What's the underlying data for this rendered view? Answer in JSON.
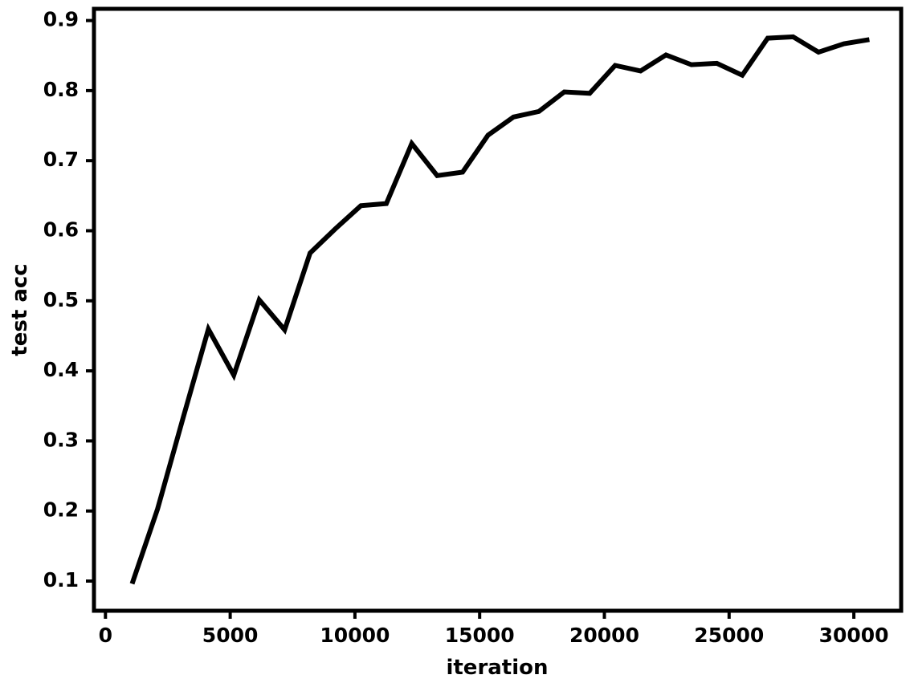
{
  "figure": {
    "background_color": "#ffffff",
    "line_color": "#000000",
    "axis_color": "#000000"
  },
  "axes": {
    "x_label": "iteration",
    "y_label": "test acc",
    "x_ticks": [
      "0",
      "5000",
      "10000",
      "15000",
      "20000",
      "25000",
      "30000"
    ],
    "y_ticks": [
      "0.1",
      "0.2",
      "0.3",
      "0.4",
      "0.5",
      "0.6",
      "0.7",
      "0.8",
      "0.9"
    ]
  },
  "chart_data": {
    "type": "line",
    "title": "",
    "xlabel": "iteration",
    "ylabel": "test acc",
    "xlim": [
      -500,
      31250
    ],
    "ylim": [
      0.0543,
      0.9171
    ],
    "grid": false,
    "legend": null,
    "x_ticks": [
      0,
      5000,
      10000,
      15000,
      20000,
      25000,
      30000
    ],
    "y_ticks": [
      0.1,
      0.2,
      0.3,
      0.4,
      0.5,
      0.6,
      0.7,
      0.8,
      0.9
    ],
    "series": [
      {
        "name": "test acc",
        "color": "#000000",
        "linewidth": 2,
        "x": [
          1000,
          2000,
          3000,
          4000,
          5000,
          6000,
          7000,
          8000,
          9000,
          10000,
          11000,
          12000,
          13000,
          14000,
          15000,
          16000,
          17000,
          18000,
          19000,
          20000,
          21000,
          22000,
          23000,
          24000,
          25000,
          26000,
          27000,
          28000,
          29000,
          30000
        ],
        "y": [
          0.093,
          0.2,
          0.33,
          0.458,
          0.392,
          0.5,
          0.457,
          0.567,
          0.602,
          0.635,
          0.638,
          0.724,
          0.678,
          0.683,
          0.736,
          0.762,
          0.77,
          0.798,
          0.796,
          0.836,
          0.828,
          0.851,
          0.837,
          0.839,
          0.822,
          0.875,
          0.877,
          0.855,
          0.867,
          0.873
        ]
      }
    ]
  }
}
